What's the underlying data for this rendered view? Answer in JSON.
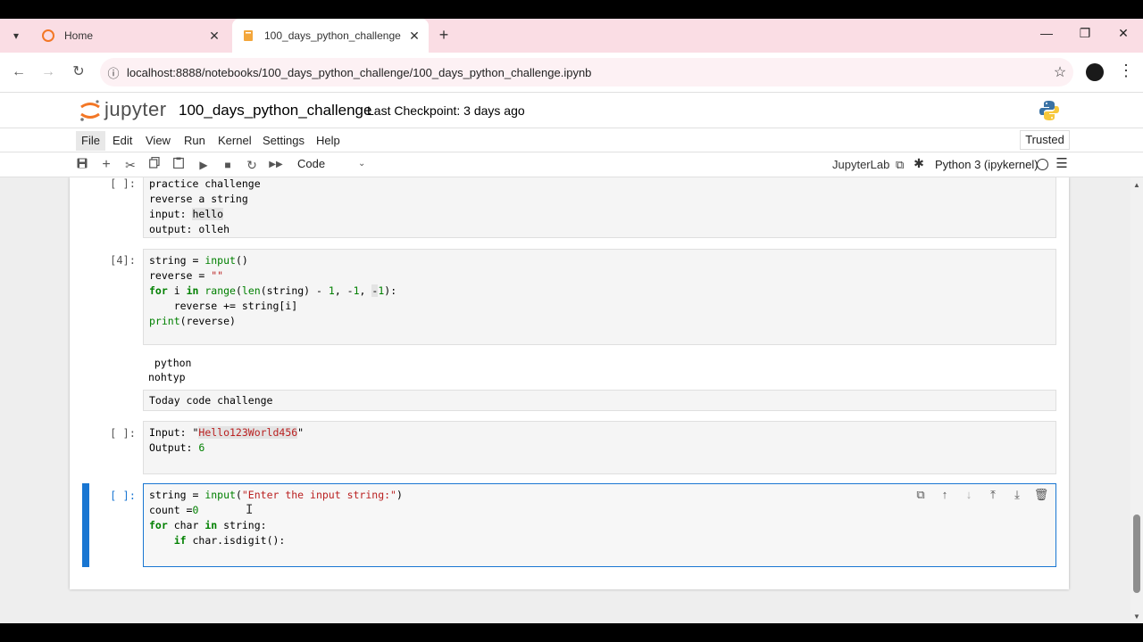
{
  "browser": {
    "tabs": [
      {
        "title": "Home"
      },
      {
        "title": "100_days_python_challenge"
      }
    ],
    "url": "localhost:8888/notebooks/100_days_python_challenge/100_days_python_challenge.ipynb"
  },
  "jupyter": {
    "brand": "jupyter",
    "notebook_name": "100_days_python_challenge",
    "checkpoint": "Last Checkpoint: 3 days ago"
  },
  "menu": [
    "File",
    "Edit",
    "View",
    "Run",
    "Kernel",
    "Settings",
    "Help"
  ],
  "trusted": "Trusted",
  "toolbar": {
    "cell_type": "Code",
    "jupyterlab_label": "JupyterLab",
    "kernel": "Python 3 (ipykernel)"
  },
  "cells": {
    "c1": {
      "prompt": "[ ]:",
      "lines": [
        "practice challenge",
        "reverse a string",
        "input: hello",
        "output: olleh"
      ]
    },
    "c2": {
      "prompt": "[4]:",
      "lines": [
        "string = input()",
        "reverse = \"\"",
        "for i in range(len(string) - 1, -1, -1):",
        "    reverse += string[i]",
        "print(reverse)"
      ],
      "output": [
        " python",
        "nohtyp"
      ]
    },
    "c3": {
      "lines": [
        "Today code challenge"
      ]
    },
    "c4": {
      "prompt": "[ ]:",
      "lines": [
        "Input: \"Hello123World456\"",
        "Output: 6"
      ]
    },
    "c5": {
      "prompt": "[ ]:",
      "lines": [
        "string = input(\"Enter the input string:\")",
        "count =0",
        "for char in string:",
        "    if char.isdigit():"
      ]
    }
  }
}
